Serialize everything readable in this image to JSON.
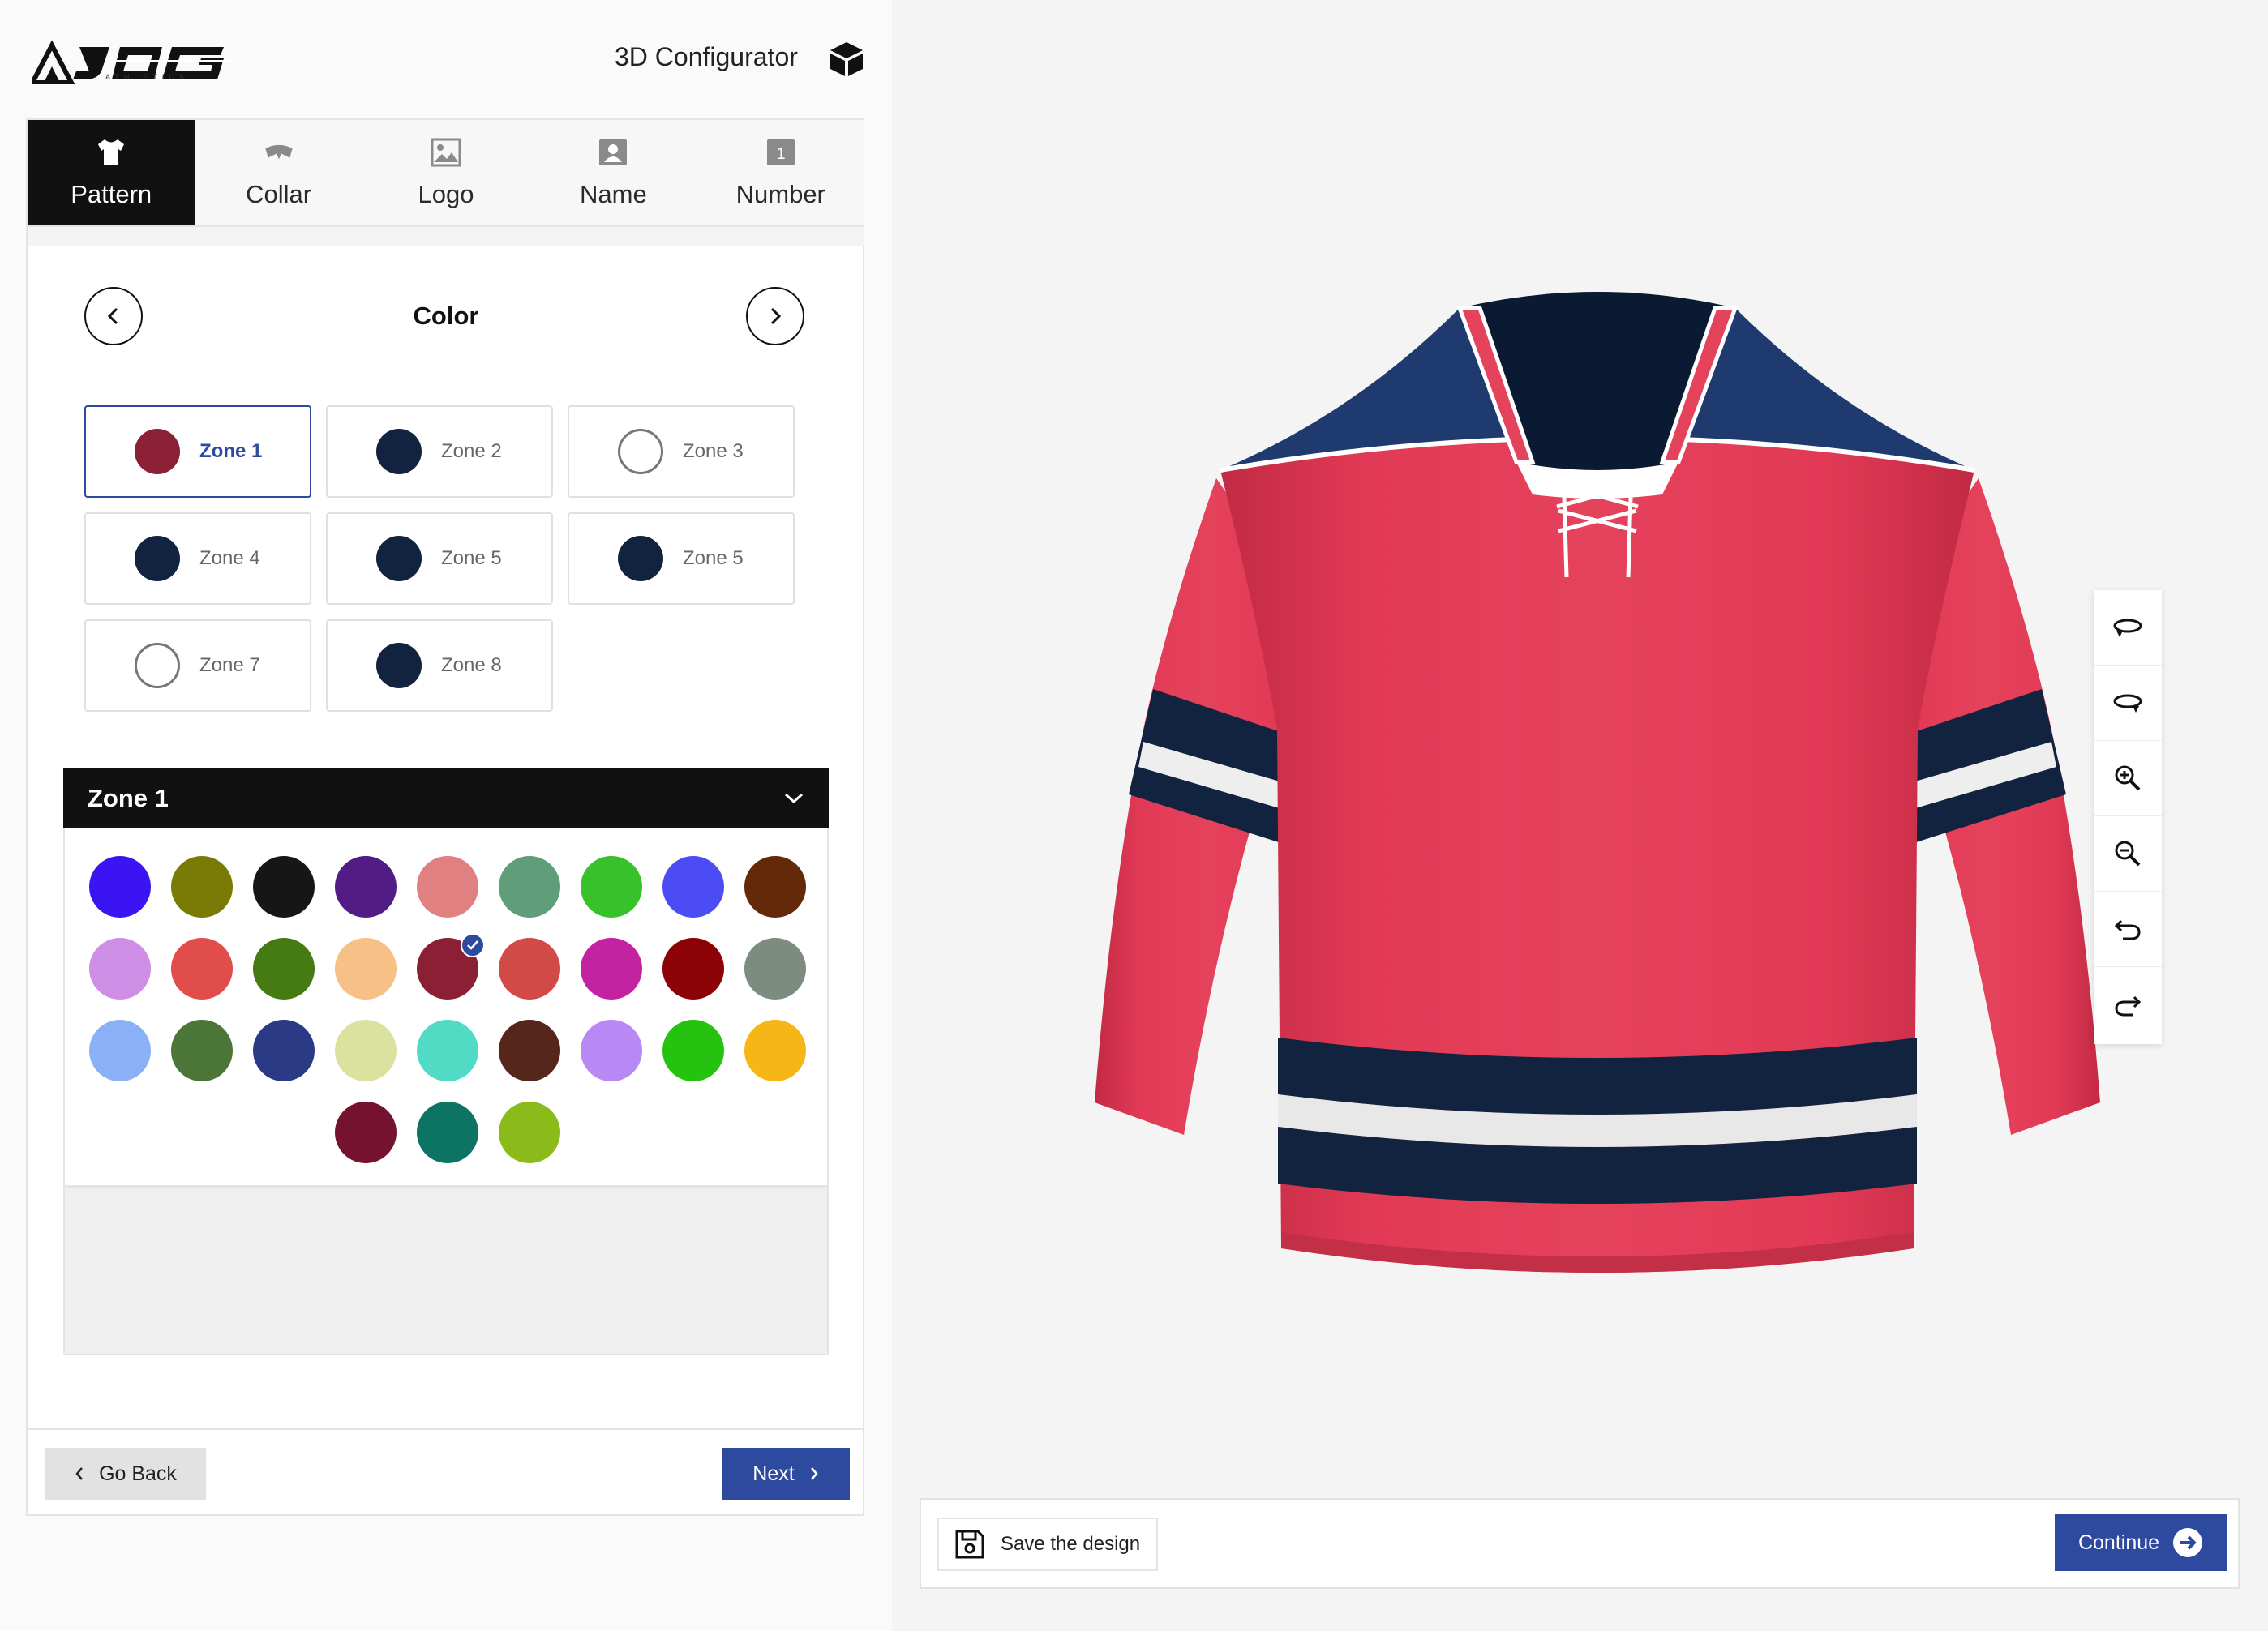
{
  "header": {
    "brand": "JOG",
    "brand_sub": "ATHLETICS",
    "title": "3D Configurator"
  },
  "tabs": [
    {
      "label": "Pattern",
      "icon": "shirt-icon",
      "active": true
    },
    {
      "label": "Collar",
      "icon": "collar-icon",
      "active": false
    },
    {
      "label": "Logo",
      "icon": "image-icon",
      "active": false
    },
    {
      "label": "Name",
      "icon": "person-icon",
      "active": false
    },
    {
      "label": "Number",
      "icon": "number-icon",
      "active": false
    }
  ],
  "section": {
    "title": "Color"
  },
  "zones": [
    {
      "label": "Zone 1",
      "color": "#8b1f34",
      "selected": true
    },
    {
      "label": "Zone 2",
      "color": "#12233f",
      "selected": false
    },
    {
      "label": "Zone 3",
      "color": "#ffffff",
      "selected": false
    },
    {
      "label": "Zone 4",
      "color": "#12233f",
      "selected": false
    },
    {
      "label": "Zone 5",
      "color": "#12233f",
      "selected": false
    },
    {
      "label": "Zone 5",
      "color": "#12233f",
      "selected": false
    },
    {
      "label": "Zone 7",
      "color": "#ffffff",
      "selected": false
    },
    {
      "label": "Zone 8",
      "color": "#12233f",
      "selected": false
    }
  ],
  "zone_panel": {
    "title": "Zone 1"
  },
  "palette": [
    "#3a14f2",
    "#7a7b06",
    "#161616",
    "#521c86",
    "#e08080",
    "#5f9e78",
    "#37c22b",
    "#4b4cf5",
    "#642908",
    "#cf8ee6",
    "#e04d4b",
    "#467a13",
    "#f6c086",
    "#8b1f34",
    "#d14a48",
    "#c323a0",
    "#8b0307",
    "#7c8c80",
    "#8ab0f8",
    "#4c7637",
    "#2a3a84",
    "#dbe2a0",
    "#52dbc4",
    "#55261a",
    "#b888f5",
    "#25c20f",
    "#f6b617",
    "#74122f",
    "#0d7362",
    "#8bbb1a"
  ],
  "palette_selected_index": 13,
  "footer": {
    "back_label": "Go Back",
    "next_label": "Next"
  },
  "viewer_tools": [
    "rotate-left-icon",
    "rotate-right-icon",
    "zoom-in-icon",
    "zoom-out-icon",
    "undo-icon",
    "redo-icon"
  ],
  "bottom_bar": {
    "save_label": "Save the design",
    "continue_label": "Continue"
  },
  "colors": {
    "accent": "#2d4a9e",
    "jersey_red": "#e03a55",
    "jersey_navy": "#12233f"
  }
}
